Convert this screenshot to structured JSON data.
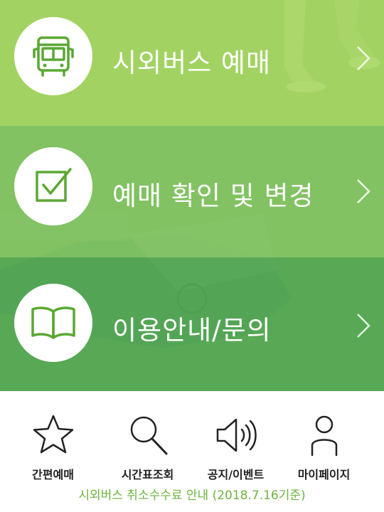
{
  "menu": {
    "items": [
      {
        "label": "시외버스 예매",
        "icon": "bus-icon"
      },
      {
        "label": "예매 확인 및 변경",
        "icon": "checkbox-icon"
      },
      {
        "label": "이용안내/문의",
        "icon": "book-icon"
      }
    ]
  },
  "toolbar": {
    "items": [
      {
        "label": "간편예매",
        "icon": "star-icon"
      },
      {
        "label": "시간표조회",
        "icon": "search-icon"
      },
      {
        "label": "공지/이벤트",
        "icon": "speaker-icon"
      },
      {
        "label": "마이페이지",
        "icon": "person-icon"
      }
    ]
  },
  "notice": {
    "text": "시외버스 취소수수료 안내 (2018.7.16기준)"
  },
  "colors": {
    "brand_green": "#6db33f",
    "icon_green": "#5aa832",
    "band_top": "#a8d660",
    "band_mid": "#7ec060",
    "band_bottom": "#4aa050"
  }
}
